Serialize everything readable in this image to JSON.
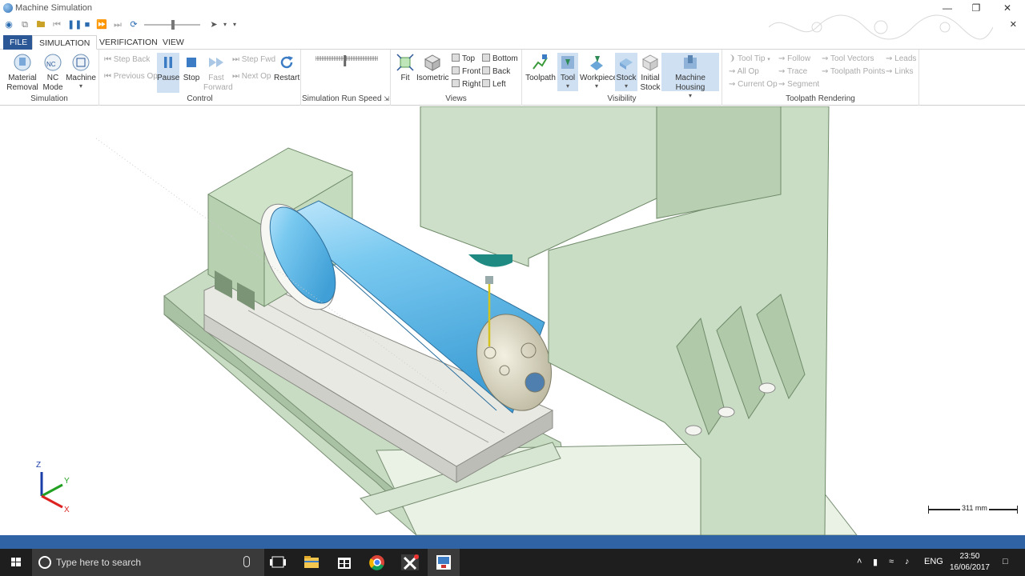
{
  "window": {
    "title": "Machine Simulation"
  },
  "tabs": [
    {
      "label": "FILE"
    },
    {
      "label": "SIMULATION"
    },
    {
      "label": "VERIFICATION"
    },
    {
      "label": "VIEW"
    }
  ],
  "ribbon": {
    "simulation": {
      "label": "Simulation",
      "material_removal": "Material Removal",
      "nc_mode": "NC Mode",
      "machine": "Machine",
      "nc_badge": "NC"
    },
    "control": {
      "label": "Control",
      "step_back": "Step Back",
      "previous_op": "Previous Op",
      "pause": "Pause",
      "stop": "Stop",
      "fast_forward": "Fast Forward",
      "step_fwd": "Step Fwd",
      "next_op": "Next Op",
      "restart": "Restart"
    },
    "speed": {
      "label": "Simulation Run Speed",
      "value_fraction": 0.47
    },
    "views": {
      "label": "Views",
      "fit": "Fit",
      "isometric": "Isometric",
      "top": "Top",
      "front": "Front",
      "right": "Right",
      "bottom": "Bottom",
      "back": "Back",
      "left": "Left"
    },
    "visibility": {
      "label": "Visibility",
      "toolpath": "Toolpath",
      "tool": "Tool",
      "workpiece": "Workpiece",
      "stock": "Stock",
      "initial_stock": "Initial Stock",
      "machine_housing": "Machine Housing"
    },
    "rendering": {
      "label": "Toolpath Rendering",
      "tool_tip": "Tool Tip",
      "all_op": "All Op",
      "current_op": "Current Op",
      "follow": "Follow",
      "trace": "Trace",
      "segment": "Segment",
      "tool_vectors": "Tool Vectors",
      "toolpath_points": "Toolpath Points",
      "leads": "Leads",
      "links": "Links"
    }
  },
  "viewport": {
    "axes": {
      "z": "Z",
      "y": "Y",
      "x": "X"
    },
    "scale": "311 mm"
  },
  "taskbar": {
    "search_placeholder": "Type here to search",
    "language": "ENG",
    "time": "23:50",
    "date": "16/06/2017"
  },
  "colors": {
    "accent": "#2b5797",
    "status_strip": "#2f63a3",
    "machine_green": "#c9dcc4",
    "cylinder_blue": "#6cc0ec",
    "selected_bg": "#cfe0f2"
  },
  "icons": {
    "pause": "pause-icon",
    "stop": "stop-icon",
    "restart": "restart-icon",
    "fit": "fit-icon",
    "isometric": "isometric-cube-icon"
  }
}
